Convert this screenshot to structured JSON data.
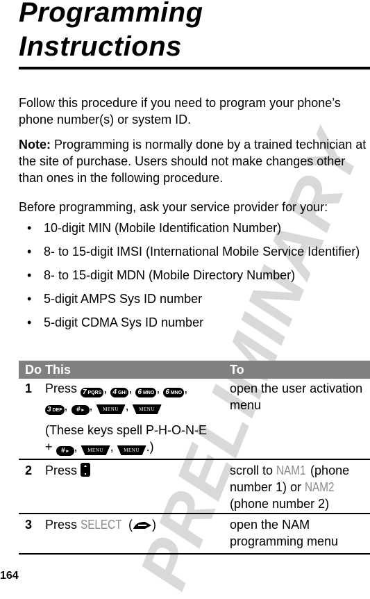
{
  "watermark": "PRELIMINARY",
  "page": {
    "title_line1": "Programming",
    "title_line2": "Instructions",
    "intro": "Follow this procedure if you need to program your phone’s phone number(s) or system ID.",
    "note_label": "Note:",
    "note_text": " Programming is normally done by a trained technician at the site of purchase. Users should not make changes other than ones in the following procedure.",
    "before_text": "Before programming, ask your service provider for your:",
    "bullets": [
      "10-digit MIN (Mobile Identification Number)",
      "8- to 15-digit IMSI (International Mobile Service Identifier)",
      "8- to 15-digit MDN (Mobile Directory Number)",
      "5-digit AMPS Sys ID number",
      "5-digit CDMA Sys ID number"
    ],
    "bullet_glyph": "•",
    "page_number": "164"
  },
  "table": {
    "header_do": "Do This",
    "header_to": "To",
    "rows": [
      {
        "num": "1",
        "press": "Press",
        "keys": [
          {
            "main": "7",
            "sub": "PQRS",
            "icon": "key-7-icon"
          },
          {
            "main": "4",
            "sub": "GHI",
            "icon": "key-4-icon"
          },
          {
            "main": "6",
            "sub": "MNO",
            "icon": "key-6-icon"
          },
          {
            "main": "6",
            "sub": "MNO",
            "icon": "key-6-icon"
          },
          {
            "main": "3",
            "sub": "DEF",
            "icon": "key-3-icon"
          },
          {
            "main": "#",
            "sub": "▸",
            "icon": "key-pound-icon"
          }
        ],
        "menu_label": "MENU",
        "note_text": "(These keys spell P-H-O-N-E",
        "note_plus": "+",
        "note_end": ".)",
        "sep": ",",
        "to": "open the user activation menu"
      },
      {
        "num": "2",
        "press": "Press",
        "to_prefix": "scroll to ",
        "to_term1": "NAM1",
        "to_mid": " (phone number 1) or ",
        "to_term2": "NAM2",
        "to_suffix": " (phone number 2)"
      },
      {
        "num": "3",
        "press": "Press ",
        "term": "SELECT",
        "paren_open": " (",
        "paren_close": ")",
        "to": "open the NAM programming menu"
      }
    ]
  }
}
